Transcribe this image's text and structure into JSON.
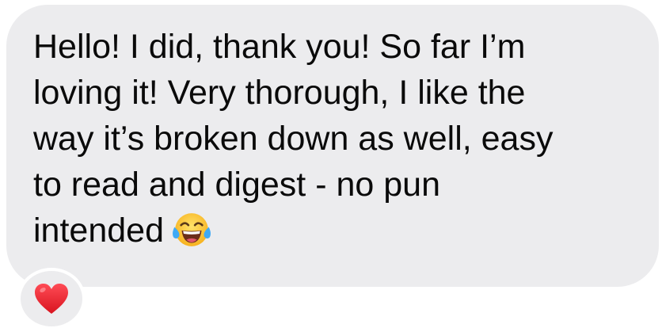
{
  "message": {
    "lines": [
      "Hello! I did, thank you!  So far I’m",
      "loving it! Very thorough, I like the",
      "way it’s broken down as well, easy",
      "to read and digest - no pun",
      "intended"
    ],
    "emoji": "face-with-tears-of-joy-icon"
  },
  "reaction": {
    "icon": "red-heart-icon",
    "color": "#e31b2b"
  },
  "colors": {
    "bubble_background": "#ececee",
    "text": "#0a0a0a"
  }
}
